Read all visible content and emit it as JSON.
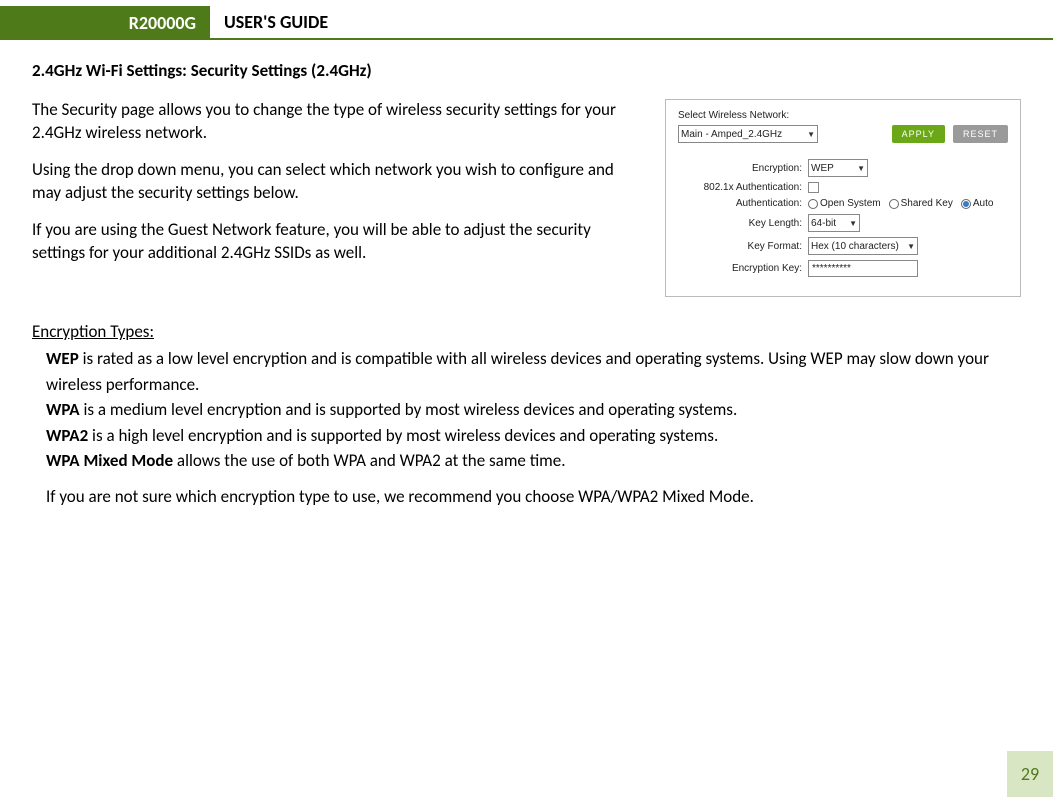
{
  "header": {
    "model": "R20000G",
    "title": "USER'S GUIDE"
  },
  "section_heading": "2.4GHz Wi-Fi Settings: Security Settings (2.4GHz)",
  "paragraphs": {
    "p1": "The Security page allows you to change the type of wireless security settings for your 2.4GHz wireless network.",
    "p2": "Using the drop down menu, you can select which network you wish to configure and may adjust the security settings below.",
    "p3": "If you are using the Guest Network feature, you will be able to adjust the security settings for your additional 2.4GHz SSIDs as well."
  },
  "screenshot": {
    "select_network_label": "Select Wireless Network:",
    "network_value": "Main - Amped_2.4GHz",
    "apply": "APPLY",
    "reset": "RESET",
    "rows": {
      "encryption_label": "Encryption:",
      "encryption_value": "WEP",
      "auth8021x_label": "802.1x Authentication:",
      "authentication_label": "Authentication:",
      "auth_open": "Open System",
      "auth_shared": "Shared Key",
      "auth_auto": "Auto",
      "keylength_label": "Key Length:",
      "keylength_value": "64-bit",
      "keyformat_label": "Key Format:",
      "keyformat_value": "Hex (10 characters)",
      "enckey_label": "Encryption Key:",
      "enckey_value": "**********"
    }
  },
  "encryption": {
    "heading": "Encryption Types:",
    "wep_bold": "WEP",
    "wep_text": " is rated as a low level encryption and is compatible with all wireless devices and operating systems. Using WEP may slow down your wireless performance.",
    "wpa_bold": "WPA",
    "wpa_text": " is a medium level encryption and is supported by most wireless devices and operating systems.",
    "wpa2_bold": "WPA2",
    "wpa2_text": " is a high level encryption and is supported by most wireless devices and operating systems.",
    "mixed_bold": "WPA Mixed Mode",
    "mixed_text": " allows the use of both WPA and WPA2 at the same time.",
    "recommend": "If you are not sure which encryption type to use, we recommend you choose WPA/WPA2 Mixed Mode."
  },
  "page_number": "29"
}
